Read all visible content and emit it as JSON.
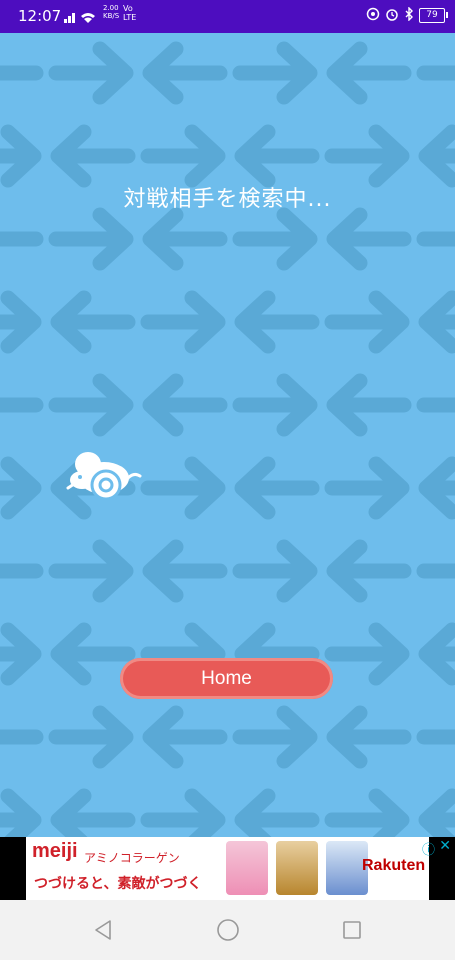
{
  "status_bar": {
    "time": "12:07",
    "network_speed_value": "2.00",
    "network_speed_unit": "KB/S",
    "network_vo": "Vo",
    "network_lte": "LTE",
    "battery": "79"
  },
  "game": {
    "searching_text": "対戦相手を検索中...",
    "home_button_label": "Home"
  },
  "ad": {
    "brand": "meiji",
    "product": "アミノコラーゲン",
    "slogan": "つづけると、素敵がつづく",
    "retailer": "Rakuten",
    "info_symbol": "ⓘ",
    "close_symbol": "✕"
  },
  "colors": {
    "status_bar": "#4d0dbf",
    "background": "#6ebdec",
    "arrows": "#5aa9d6",
    "home_button": "#e85a57",
    "ad_red": "#d0212a"
  }
}
